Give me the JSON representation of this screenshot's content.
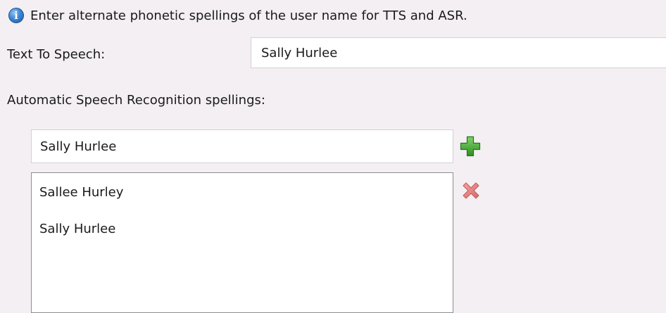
{
  "info": {
    "icon": "info-icon",
    "text": "Enter alternate phonetic spellings of the user name for TTS and ASR."
  },
  "tts": {
    "label": "Text To Speech:",
    "value": "Sally Hurlee"
  },
  "asr": {
    "label": "Automatic Speech Recognition spellings:",
    "input_value": "Sally Hurlee",
    "add_icon": "plus-icon",
    "remove_icon": "delete-x-icon",
    "items": [
      {
        "label": "Sallee Hurley"
      },
      {
        "label": "Sally Hurlee"
      }
    ]
  },
  "colors": {
    "background": "#f3eff3",
    "add_green": "#3aa32a",
    "remove_red": "#e07b7b",
    "info_blue": "#3f86d6"
  }
}
